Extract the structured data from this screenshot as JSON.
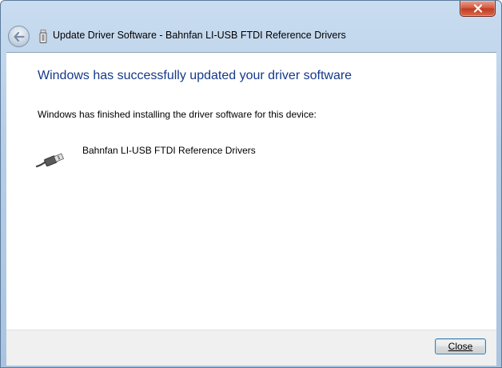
{
  "window": {
    "title": "Update Driver Software - Bahnfan LI-USB FTDI Reference Drivers"
  },
  "content": {
    "heading": "Windows has successfully updated your driver software",
    "message": "Windows has finished installing the driver software for this device:",
    "device_name": "Bahnfan LI-USB FTDI Reference Drivers"
  },
  "footer": {
    "close_label": "Close"
  },
  "icons": {
    "title": "usb-drive-icon",
    "back": "back-arrow-icon",
    "device": "usb-cable-icon",
    "window_close": "close-icon"
  },
  "colors": {
    "heading": "#15398a",
    "titlebar": "#b6cde6",
    "close_button": "#c23a20",
    "default_button_border": "#3c7fb1"
  }
}
